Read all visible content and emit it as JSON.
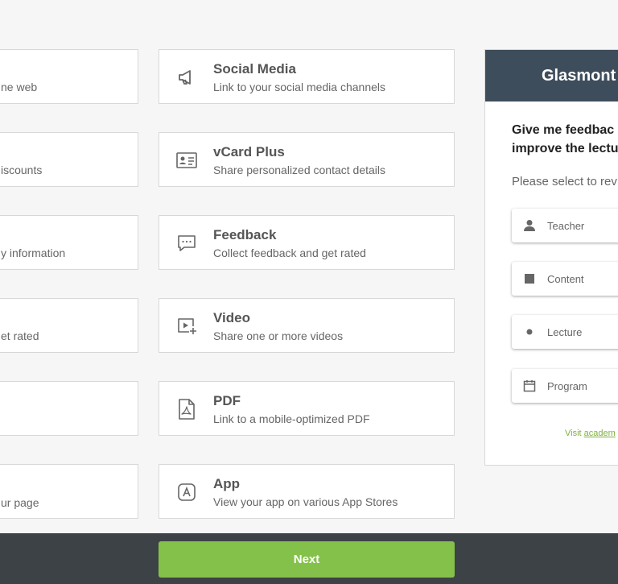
{
  "left_column": [
    {
      "desc": "ne web"
    },
    {
      "desc": "iscounts"
    },
    {
      "desc": "y information"
    },
    {
      "desc": "et rated"
    },
    {
      "desc": ""
    },
    {
      "desc": "ur page"
    }
  ],
  "cards": [
    {
      "icon": "megaphone-icon",
      "title": "Social Media",
      "desc": "Link to your social media channels"
    },
    {
      "icon": "vcard-icon",
      "title": "vCard Plus",
      "desc": "Share personalized contact details"
    },
    {
      "icon": "chat-bubble-icon",
      "title": "Feedback",
      "desc": "Collect feedback and get rated"
    },
    {
      "icon": "video-icon",
      "title": "Video",
      "desc": "Share one or more videos"
    },
    {
      "icon": "pdf-icon",
      "title": "PDF",
      "desc": "Link to a mobile-optimized PDF"
    },
    {
      "icon": "app-icon",
      "title": "App",
      "desc": "View your app on various App Stores"
    }
  ],
  "footer": {
    "next_label": "Next"
  },
  "preview": {
    "header": "Glasmont",
    "question_line1": "Give me feedbac",
    "question_line2": "improve the lectu",
    "subtitle": "Please select to rev",
    "options": [
      {
        "icon": "person-icon",
        "label": "Teacher"
      },
      {
        "icon": "square-icon",
        "label": "Content"
      },
      {
        "icon": "dot-icon",
        "label": "Lecture"
      },
      {
        "icon": "calendar-icon",
        "label": "Program"
      }
    ],
    "visit_prefix": "Visit ",
    "visit_link": "academ"
  },
  "colors": {
    "accent": "#84c14a",
    "header": "#3e4d5b",
    "bar": "#3d4246"
  }
}
